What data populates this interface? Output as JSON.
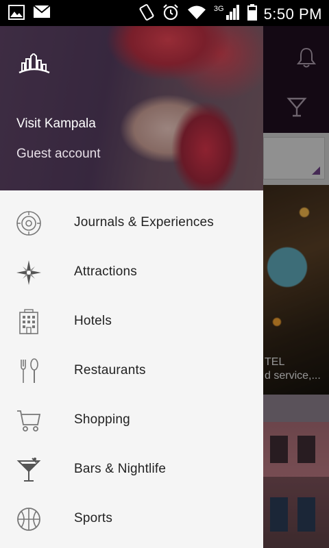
{
  "status_bar": {
    "network_type": "3G",
    "time": "5:50 PM"
  },
  "drawer": {
    "app_name": "Visit Kampala",
    "account_type": "Guest account",
    "menu": [
      {
        "label": "Journals & Experiences",
        "icon": "journal-icon"
      },
      {
        "label": "Attractions",
        "icon": "compass-icon"
      },
      {
        "label": "Hotels",
        "icon": "hotel-icon"
      },
      {
        "label": "Restaurants",
        "icon": "fork-spoon-icon"
      },
      {
        "label": "Shopping",
        "icon": "cart-icon"
      },
      {
        "label": "Bars & Nightlife",
        "icon": "cocktail-icon"
      },
      {
        "label": "Sports",
        "icon": "basketball-icon"
      }
    ]
  },
  "background": {
    "card_title_fragment": "TEL",
    "card_subtitle_fragment": "d service,..."
  },
  "colors": {
    "drawer_bg": "#f5f5f5",
    "header_purple": "#1f0e20",
    "accent_purple": "#6b3f82"
  }
}
